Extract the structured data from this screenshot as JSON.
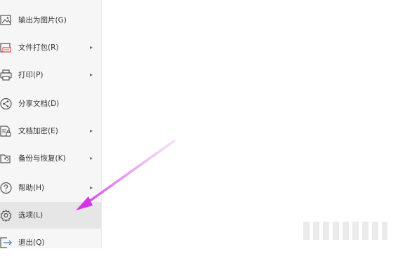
{
  "menu": {
    "items": [
      {
        "label": "输出为图片(G)",
        "icon": "image-export-icon",
        "has_submenu": false
      },
      {
        "label": "文件打包(R)",
        "icon": "package-icon",
        "has_submenu": true
      },
      {
        "label": "打印(P)",
        "icon": "printer-icon",
        "has_submenu": true
      },
      {
        "label": "分享文档(D)",
        "icon": "share-icon",
        "has_submenu": false
      },
      {
        "label": "文档加密(E)",
        "icon": "document-lock-icon",
        "has_submenu": true
      },
      {
        "label": "备份与恢复(K)",
        "icon": "backup-restore-icon",
        "has_submenu": true
      },
      {
        "label": "帮助(H)",
        "icon": "help-icon",
        "has_submenu": true
      },
      {
        "label": "选项(L)",
        "icon": "gear-icon",
        "has_submenu": false,
        "highlighted": true
      },
      {
        "label": "退出(Q)",
        "icon": "exit-icon",
        "has_submenu": false
      }
    ],
    "chevron_glyph": "▸"
  },
  "colors": {
    "panel_bg": "#f6f6f6",
    "highlight_bg": "#e6e6e6",
    "text": "#333333",
    "arrow": "#d633e8"
  }
}
